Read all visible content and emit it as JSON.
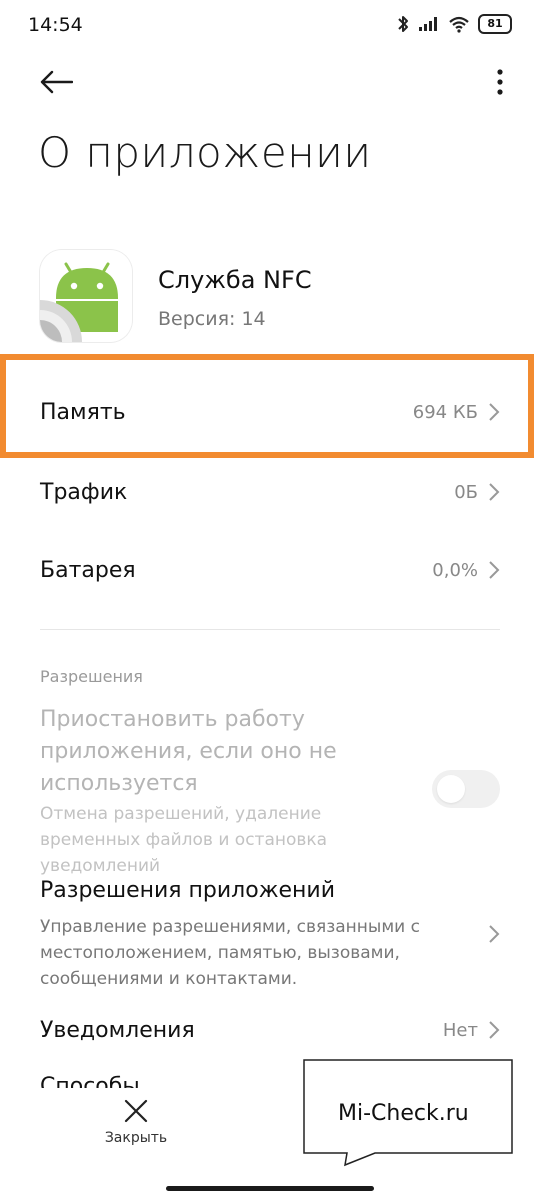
{
  "status_bar": {
    "time": "14:54",
    "battery": "81",
    "icons": [
      "bluetooth-icon",
      "signal-icon",
      "wifi-icon",
      "battery-icon"
    ]
  },
  "top_bar": {
    "back_icon": "arrow-left-icon",
    "more_icon": "vertical-dots-icon"
  },
  "page_title": "О приложении",
  "app": {
    "name": "Служба NFC",
    "version": "Версия: 14",
    "icon": "android-icon"
  },
  "rows": [
    {
      "label": "Память",
      "value": "694 КБ"
    },
    {
      "label": "Трафик",
      "value": "0Б"
    },
    {
      "label": "Батарея",
      "value": "0,0%"
    }
  ],
  "permissions": {
    "section_label": "Разрешения",
    "pause": {
      "title": "Приостановить работу приложения, если оно не используется",
      "description": "Отмена разрешений, удаление временных файлов и остановка уведомлений",
      "enabled": false
    },
    "app_permissions": {
      "title": "Разрешения приложений",
      "description": "Управление разрешениями, связанными с местоположением, памятью, вызовами, сообщениями и контактами."
    },
    "notifications": {
      "label": "Уведомления",
      "value": "Нет"
    },
    "partial_next_row": "Способы"
  },
  "bottom_bar": {
    "close_label": "Закрыть",
    "close_icon": "close-x-icon"
  },
  "watermark": "Mi-Check.ru",
  "colors": {
    "highlight": "#f28b30",
    "android_green": "#8bc34a",
    "text_primary": "#111111",
    "text_secondary": "#888888",
    "text_disabled": "#b4b4b4"
  }
}
